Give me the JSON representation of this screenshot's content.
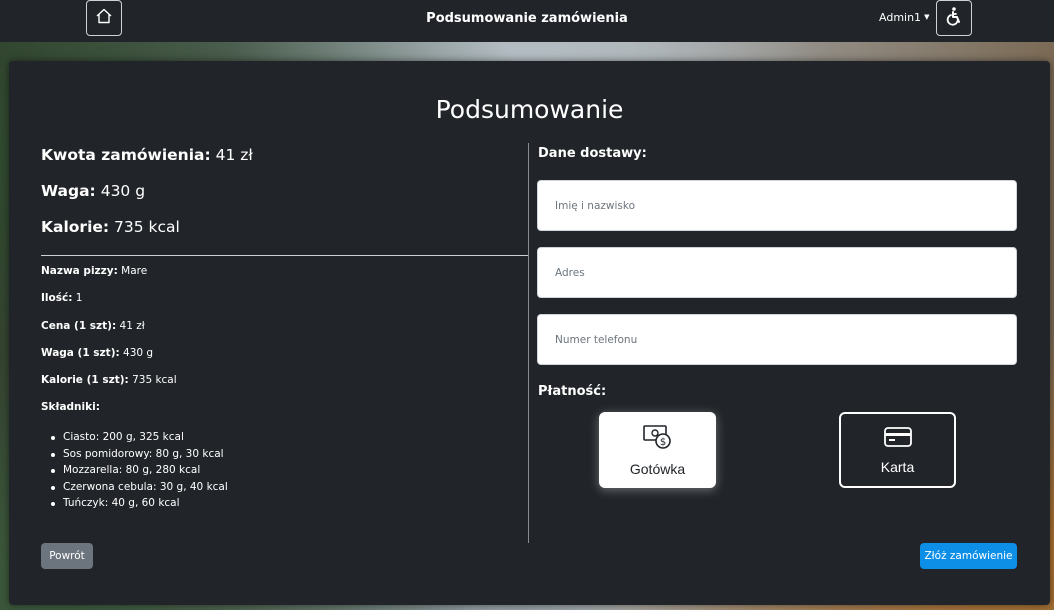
{
  "navbar": {
    "title": "Podsumowanie zamówienia",
    "user": "Admin1",
    "home_icon": "home-icon",
    "accessibility_icon": "wheelchair-icon"
  },
  "summary": {
    "heading": "Podsumowanie",
    "amount_label": "Kwota zamówienia:",
    "amount_value": "41 zł",
    "weight_label": "Waga:",
    "weight_value": "430 g",
    "calories_label": "Kalorie:",
    "calories_value": "735 kcal"
  },
  "details": {
    "pizza_name_label": "Nazwa pizzy:",
    "pizza_name_value": "Mare",
    "qty_label": "Ilość:",
    "qty_value": "1",
    "price_label": "Cena (1 szt):",
    "price_value": "41 zł",
    "weight_label": "Waga (1 szt):",
    "weight_value": "430 g",
    "calories_label": "Kalorie (1 szt):",
    "calories_value": "735 kcal",
    "ingredients_label": "Składniki:",
    "ingredients": [
      "Ciasto: 200 g, 325 kcal",
      "Sos pomidorowy: 80 g, 30 kcal",
      "Mozzarella: 80 g, 280 kcal",
      "Czerwona cebula: 30 g, 40 kcal",
      "Tuńczyk: 40 g, 60 kcal"
    ]
  },
  "delivery": {
    "label": "Dane dostawy:",
    "name_placeholder": "Imię i nazwisko",
    "address_placeholder": "Adres",
    "phone_placeholder": "Numer telefonu"
  },
  "payment": {
    "label": "Płatność:",
    "cash_label": "Gotówka",
    "card_label": "Karta",
    "selected": "Gotówka"
  },
  "actions": {
    "back_label": "Powrót",
    "submit_label": "Złóż zamówienie"
  },
  "colors": {
    "card_bg": "#212529",
    "submit": "#0d8fe8",
    "back": "#6c757d"
  }
}
